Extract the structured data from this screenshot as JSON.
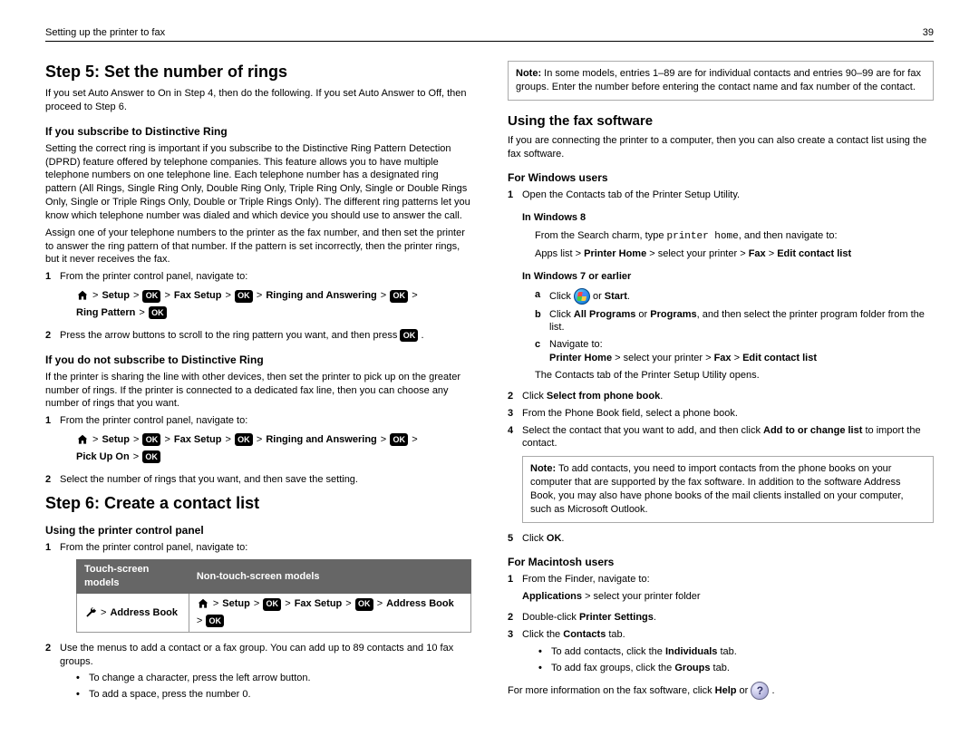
{
  "header": {
    "left": "Setting up the printer to fax",
    "right": "39"
  },
  "ok": "OK",
  "left": {
    "step5": {
      "title": "Step 5: Set the number of rings",
      "intro": "If you set Auto Answer to On in Step 4, then do the following. If you set Auto Answer to Off, then proceed to Step 6.",
      "sub1": {
        "title": "If you subscribe to Distinctive Ring",
        "p1": "Setting the correct ring is important if you subscribe to the Distinctive Ring Pattern Detection (DPRD) feature offered by telephone companies. This feature allows you to have multiple telephone numbers on one telephone line. Each telephone number has a designated ring pattern (All Rings, Single Ring Only, Double Ring Only, Triple Ring Only, Single or Double Rings Only, Single or Triple Rings Only, Double or Triple Rings Only). The different ring patterns let you know which telephone number was dialed and which device you should use to answer the call.",
        "p2": "Assign one of your telephone numbers to the printer as the fax number, and then set the printer to answer the ring pattern of that number. If the pattern is set incorrectly, then the printer rings, but it never receives the fax.",
        "li1": "From the printer control panel, navigate to:",
        "path": {
          "setup": "Setup",
          "fax": "Fax Setup",
          "ring": "Ringing and Answering",
          "pattern": "Ring Pattern"
        },
        "li2a": "Press the arrow buttons to scroll to the ring pattern you want, and then press ",
        "li2b": "."
      },
      "sub2": {
        "title": "If you do not subscribe to Distinctive Ring",
        "p1": "If the printer is sharing the line with other devices, then set the printer to pick up on the greater number of rings. If the printer is connected to a dedicated fax line, then you can choose any number of rings that you want.",
        "li1": "From the printer control panel, navigate to:",
        "path": {
          "setup": "Setup",
          "fax": "Fax Setup",
          "ring": "Ringing and Answering",
          "pick": "Pick Up On"
        },
        "li2": "Select the number of rings that you want, and then save the setting."
      }
    },
    "step6": {
      "title": "Step 6: Create a contact list",
      "sub1": {
        "title": "Using the printer control panel",
        "li1": "From the printer control panel, navigate to:",
        "table": {
          "h1": "Touch-screen models",
          "h2": "Non-touch-screen models",
          "c1": {
            "ab": "Address Book"
          },
          "c2": {
            "setup": "Setup",
            "fax": "Fax Setup",
            "ab": "Address Book"
          }
        },
        "li2": "Use the menus to add a contact or a fax group. You can add up to 89 contacts and 10 fax groups.",
        "b1": "To change a character, press the left arrow button.",
        "b2": "To add a space, press the number 0."
      }
    }
  },
  "right": {
    "note": "In some models, entries 1–89 are for individual contacts and entries 90–99 are for fax groups. Enter the number before entering the contact name and fax number of the contact.",
    "h2": "Using the fax software",
    "p1": "If you are connecting the printer to a computer, then you can also create a contact list using the fax software.",
    "win": {
      "title": "For Windows users",
      "li1": "Open the Contacts tab of the Printer Setup Utility.",
      "w8": {
        "title": "In Windows 8",
        "p_a": "From the Search charm, type ",
        "p_code": "printer home",
        "p_b": ", and then navigate to:",
        "path_a": "Apps list > ",
        "path_b": "Printer Home",
        "path_c": " > select your printer > ",
        "path_d": "Fax",
        "path_e": " > ",
        "path_f": "Edit contact list"
      },
      "w7": {
        "title": "In Windows 7 or earlier",
        "a_a": "Click ",
        "a_b": " or ",
        "a_c": "Start",
        "a_d": ".",
        "b_a": "Click ",
        "b_b": "All Programs",
        "b_c": " or ",
        "b_d": "Programs",
        "b_e": ", and then select the printer program folder from the list.",
        "c": "Navigate to:",
        "c_path_a": "Printer Home",
        "c_path_b": " > select your printer > ",
        "c_path_c": "Fax",
        "c_path_d": " > ",
        "c_path_e": "Edit contact list",
        "after": "The Contacts tab of the Printer Setup Utility opens."
      },
      "li2_a": "Click ",
      "li2_b": "Select from phone book",
      "li2_c": ".",
      "li3": "From the Phone Book field, select a phone book.",
      "li4_a": "Select the contact that you want to add, and then click ",
      "li4_b": "Add to or change list",
      "li4_c": " to import the contact.",
      "li4_note_a": "Note:",
      "li4_note_b": " To add contacts, you need to import contacts from the phone books on your computer that are supported by the fax software. In addition to the software Address Book, you may also have phone books of the mail clients installed on your computer, such as Microsoft Outlook.",
      "li5_a": "Click ",
      "li5_b": "OK",
      "li5_c": "."
    },
    "mac": {
      "title": "For Macintosh users",
      "li1": "From the Finder, navigate to:",
      "li1_path_a": "Applications",
      "li1_path_b": " > select your printer folder",
      "li2_a": "Double-click ",
      "li2_b": "Printer Settings",
      "li2_c": ".",
      "li3_a": "Click the ",
      "li3_b": "Contacts",
      "li3_c": " tab.",
      "b1_a": "To add contacts, click the ",
      "b1_b": "Individuals",
      "b1_c": " tab.",
      "b2_a": "To add fax groups, click the ",
      "b2_b": "Groups",
      "b2_c": " tab."
    },
    "footer_a": "For more information on the fax software, click ",
    "footer_b": "Help",
    "footer_c": " or ",
    "footer_d": "."
  }
}
